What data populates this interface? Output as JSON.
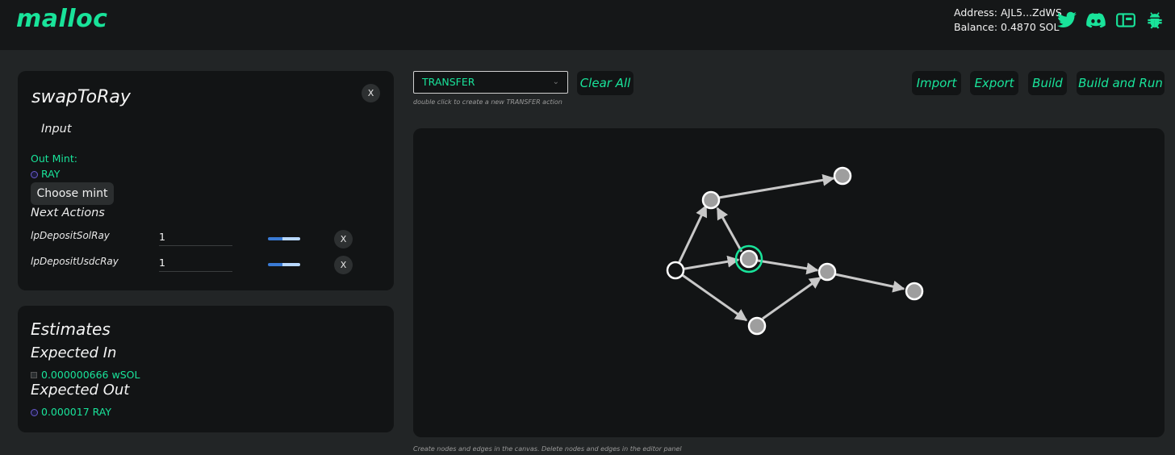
{
  "header": {
    "logo": "malloc",
    "address": "Address: AJL5...ZdWS",
    "balance": "Balance: 0.4870 SOL",
    "icons": [
      "twitter-icon",
      "discord-icon",
      "wallet-icon",
      "bug-icon"
    ],
    "accent": "#19e39a"
  },
  "action_panel": {
    "title": "swapToRay",
    "close": "X",
    "input_label": "Input",
    "out_mint_label": "Out Mint:",
    "out_mint_value": "RAY",
    "choose_mint": "Choose mint",
    "next_actions_label": "Next Actions",
    "next_actions": [
      {
        "name": "lpDepositSolRay",
        "value": "1",
        "remove": "X"
      },
      {
        "name": "lpDepositUsdcRay",
        "value": "1",
        "remove": "X"
      }
    ]
  },
  "estimates": {
    "title": "Estimates",
    "expected_in_label": "Expected In",
    "expected_in_value": "0.000000666 wSOL",
    "expected_out_label": "Expected Out",
    "expected_out_value": "0.000017 RAY"
  },
  "toolbar": {
    "action_select": "TRANSFER",
    "clear_all": "Clear All",
    "hint": "double click to create a new TRANSFER action",
    "import": "Import",
    "export": "Export",
    "build": "Build",
    "build_and_run": "Build and Run"
  },
  "canvas": {
    "footer_hint": "Create nodes and edges in the canvas. Delete nodes and edges in the editor panel"
  }
}
